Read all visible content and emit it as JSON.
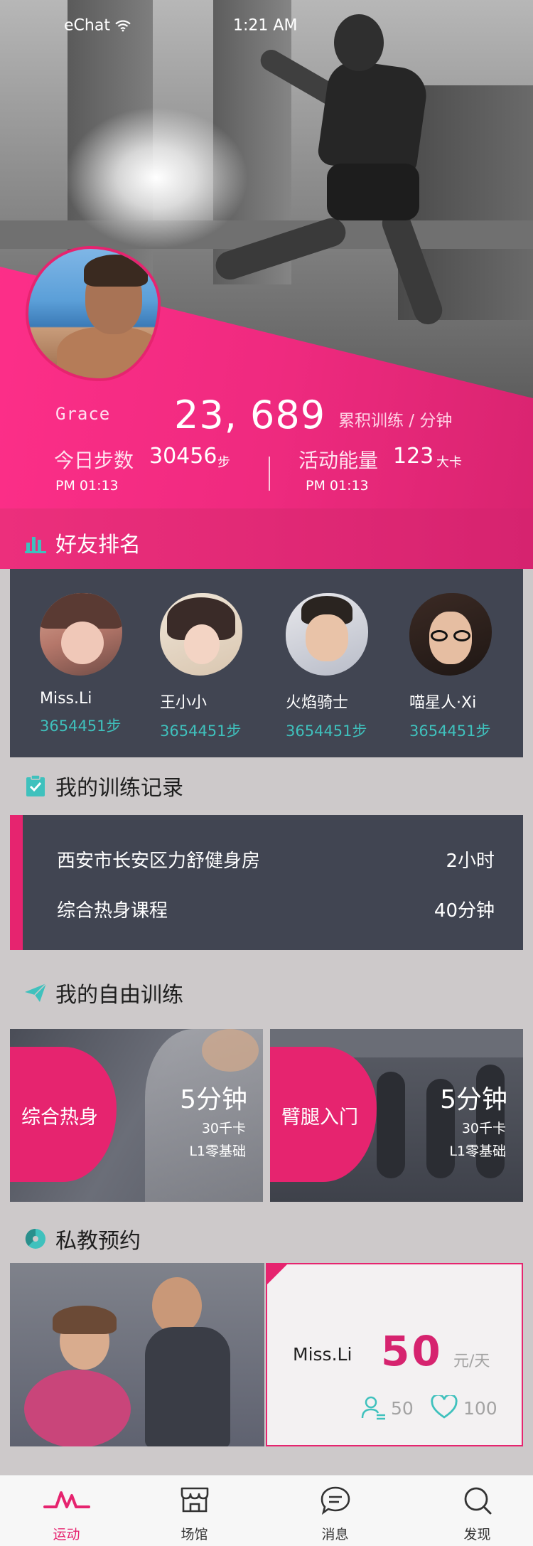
{
  "status_bar": {
    "carrier": "eChat",
    "time": "1:21 AM"
  },
  "profile": {
    "username": "Grace",
    "total_training": "23, 689",
    "total_unit": "累积训练 / 分钟",
    "steps_label": "今日步数",
    "steps_value": "30456",
    "steps_unit": "步",
    "steps_time": "PM 01:13",
    "energy_label": "活动能量",
    "energy_value": "123",
    "energy_unit": "大卡",
    "energy_time": "PM 01:13"
  },
  "friends_section": {
    "title": "好友排名",
    "friends": [
      {
        "name": "Miss.Li",
        "steps": "3654451步"
      },
      {
        "name": "王小小",
        "steps": "3654451步"
      },
      {
        "name": "火焰骑士",
        "steps": "3654451步"
      },
      {
        "name": "喵星人·Xi",
        "steps": "3654451步"
      }
    ]
  },
  "records_section": {
    "title": "我的训练记录",
    "rows": [
      {
        "name": "西安市长安区力舒健身房",
        "value": "2小时"
      },
      {
        "name": "综合热身课程",
        "value": "40分钟"
      }
    ]
  },
  "free_training_section": {
    "title": "我的自由训练",
    "cards": [
      {
        "tag": "综合热身",
        "duration": "5分钟",
        "calories": "30千卡",
        "level": "L1零基础"
      },
      {
        "tag": "臂腿入门",
        "duration": "5分钟",
        "calories": "30千卡",
        "level": "L1零基础"
      }
    ]
  },
  "coach_section": {
    "title": "私教预约",
    "coach_name": "Miss.Li",
    "price": "50",
    "price_unit": "元/天",
    "students": "50",
    "likes": "100"
  },
  "tabbar": {
    "tabs": [
      {
        "label": "运动",
        "icon": "pulse-icon"
      },
      {
        "label": "场馆",
        "icon": "store-icon"
      },
      {
        "label": "消息",
        "icon": "chat-icon"
      },
      {
        "label": "发现",
        "icon": "search-icon"
      }
    ]
  },
  "colors": {
    "accent": "#e6246f",
    "teal": "#3fc1bd",
    "dark_panel": "#414552",
    "page_bg": "#cdc9ca"
  }
}
